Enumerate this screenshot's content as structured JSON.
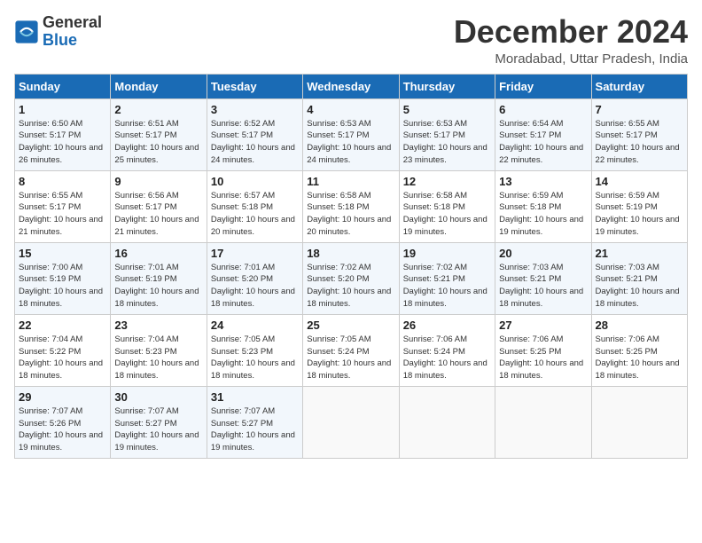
{
  "logo": {
    "text_general": "General",
    "text_blue": "Blue"
  },
  "title": "December 2024",
  "subtitle": "Moradabad, Uttar Pradesh, India",
  "days_of_week": [
    "Sunday",
    "Monday",
    "Tuesday",
    "Wednesday",
    "Thursday",
    "Friday",
    "Saturday"
  ],
  "weeks": [
    [
      {
        "day": 1,
        "sunrise": "6:50 AM",
        "sunset": "5:17 PM",
        "daylight": "10 hours and 26 minutes."
      },
      {
        "day": 2,
        "sunrise": "6:51 AM",
        "sunset": "5:17 PM",
        "daylight": "10 hours and 25 minutes."
      },
      {
        "day": 3,
        "sunrise": "6:52 AM",
        "sunset": "5:17 PM",
        "daylight": "10 hours and 24 minutes."
      },
      {
        "day": 4,
        "sunrise": "6:53 AM",
        "sunset": "5:17 PM",
        "daylight": "10 hours and 24 minutes."
      },
      {
        "day": 5,
        "sunrise": "6:53 AM",
        "sunset": "5:17 PM",
        "daylight": "10 hours and 23 minutes."
      },
      {
        "day": 6,
        "sunrise": "6:54 AM",
        "sunset": "5:17 PM",
        "daylight": "10 hours and 22 minutes."
      },
      {
        "day": 7,
        "sunrise": "6:55 AM",
        "sunset": "5:17 PM",
        "daylight": "10 hours and 22 minutes."
      }
    ],
    [
      {
        "day": 8,
        "sunrise": "6:55 AM",
        "sunset": "5:17 PM",
        "daylight": "10 hours and 21 minutes."
      },
      {
        "day": 9,
        "sunrise": "6:56 AM",
        "sunset": "5:17 PM",
        "daylight": "10 hours and 21 minutes."
      },
      {
        "day": 10,
        "sunrise": "6:57 AM",
        "sunset": "5:18 PM",
        "daylight": "10 hours and 20 minutes."
      },
      {
        "day": 11,
        "sunrise": "6:58 AM",
        "sunset": "5:18 PM",
        "daylight": "10 hours and 20 minutes."
      },
      {
        "day": 12,
        "sunrise": "6:58 AM",
        "sunset": "5:18 PM",
        "daylight": "10 hours and 19 minutes."
      },
      {
        "day": 13,
        "sunrise": "6:59 AM",
        "sunset": "5:18 PM",
        "daylight": "10 hours and 19 minutes."
      },
      {
        "day": 14,
        "sunrise": "6:59 AM",
        "sunset": "5:19 PM",
        "daylight": "10 hours and 19 minutes."
      }
    ],
    [
      {
        "day": 15,
        "sunrise": "7:00 AM",
        "sunset": "5:19 PM",
        "daylight": "10 hours and 18 minutes."
      },
      {
        "day": 16,
        "sunrise": "7:01 AM",
        "sunset": "5:19 PM",
        "daylight": "10 hours and 18 minutes."
      },
      {
        "day": 17,
        "sunrise": "7:01 AM",
        "sunset": "5:20 PM",
        "daylight": "10 hours and 18 minutes."
      },
      {
        "day": 18,
        "sunrise": "7:02 AM",
        "sunset": "5:20 PM",
        "daylight": "10 hours and 18 minutes."
      },
      {
        "day": 19,
        "sunrise": "7:02 AM",
        "sunset": "5:21 PM",
        "daylight": "10 hours and 18 minutes."
      },
      {
        "day": 20,
        "sunrise": "7:03 AM",
        "sunset": "5:21 PM",
        "daylight": "10 hours and 18 minutes."
      },
      {
        "day": 21,
        "sunrise": "7:03 AM",
        "sunset": "5:21 PM",
        "daylight": "10 hours and 18 minutes."
      }
    ],
    [
      {
        "day": 22,
        "sunrise": "7:04 AM",
        "sunset": "5:22 PM",
        "daylight": "10 hours and 18 minutes."
      },
      {
        "day": 23,
        "sunrise": "7:04 AM",
        "sunset": "5:23 PM",
        "daylight": "10 hours and 18 minutes."
      },
      {
        "day": 24,
        "sunrise": "7:05 AM",
        "sunset": "5:23 PM",
        "daylight": "10 hours and 18 minutes."
      },
      {
        "day": 25,
        "sunrise": "7:05 AM",
        "sunset": "5:24 PM",
        "daylight": "10 hours and 18 minutes."
      },
      {
        "day": 26,
        "sunrise": "7:06 AM",
        "sunset": "5:24 PM",
        "daylight": "10 hours and 18 minutes."
      },
      {
        "day": 27,
        "sunrise": "7:06 AM",
        "sunset": "5:25 PM",
        "daylight": "10 hours and 18 minutes."
      },
      {
        "day": 28,
        "sunrise": "7:06 AM",
        "sunset": "5:25 PM",
        "daylight": "10 hours and 18 minutes."
      }
    ],
    [
      {
        "day": 29,
        "sunrise": "7:07 AM",
        "sunset": "5:26 PM",
        "daylight": "10 hours and 19 minutes."
      },
      {
        "day": 30,
        "sunrise": "7:07 AM",
        "sunset": "5:27 PM",
        "daylight": "10 hours and 19 minutes."
      },
      {
        "day": 31,
        "sunrise": "7:07 AM",
        "sunset": "5:27 PM",
        "daylight": "10 hours and 19 minutes."
      },
      null,
      null,
      null,
      null
    ]
  ]
}
